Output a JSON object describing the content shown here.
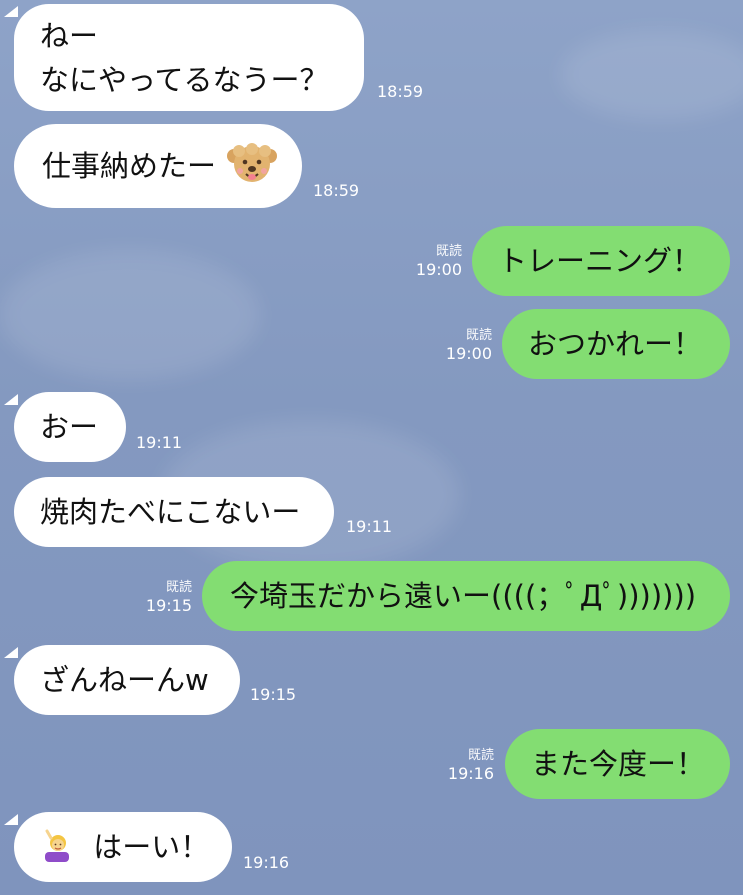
{
  "chat": {
    "read_label": "既読",
    "messages": [
      {
        "side": "in",
        "line1": "ねー",
        "line2": "なにやってるなうー？",
        "time": "18:59"
      },
      {
        "side": "in",
        "text": "仕事納めたー",
        "time": "18:59",
        "sticker": "dog-emoji"
      },
      {
        "side": "out",
        "text": "トレーニング！",
        "time": "19:00"
      },
      {
        "side": "out",
        "text": "おつかれー！",
        "time": "19:00"
      },
      {
        "side": "in",
        "text": "おー",
        "time": "19:11"
      },
      {
        "side": "in",
        "text": "焼肉たべにこないー",
        "time": "19:11"
      },
      {
        "side": "out",
        "text": "今埼玉だから遠いー((((；ﾟДﾟ)))))))",
        "time": "19:15"
      },
      {
        "side": "in",
        "text": "ざんねーんw",
        "time": "19:15"
      },
      {
        "side": "out",
        "text": "また今度ー！",
        "time": "19:16"
      },
      {
        "side": "in",
        "text": "はーい！",
        "time": "19:16",
        "emoji": "raising-hand-person-emoji"
      }
    ]
  },
  "colors": {
    "background": "#8ca1c6",
    "incoming_bubble": "#ffffff",
    "outgoing_bubble": "#83dd72",
    "meta_text": "#ffffff"
  }
}
